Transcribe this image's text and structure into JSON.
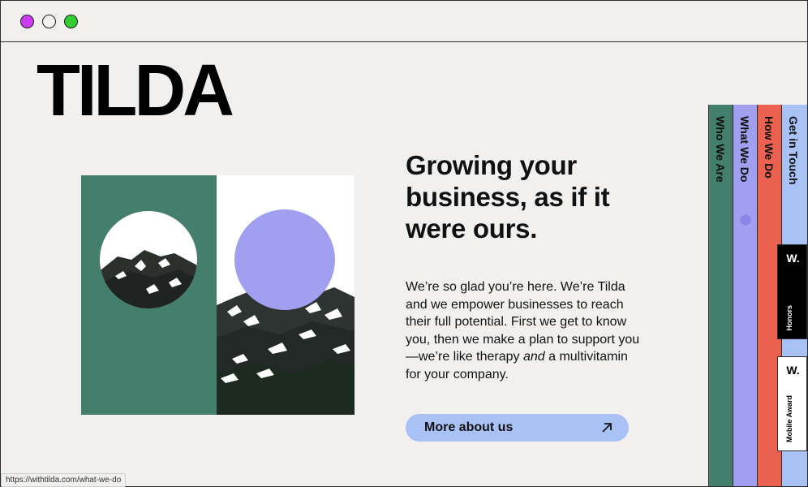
{
  "window": {
    "buttons": {
      "close_color": "#cc3cf0",
      "minimize_color": "#f1f0ee",
      "maximize_color": "#33cc33"
    }
  },
  "header": {
    "logo": "TILDA"
  },
  "hero": {
    "headline": "Growing your business, as if it were ours.",
    "body_part1": "We’re so glad you’re here. We’re Tilda and we empower businesses to reach their full potential. First we get to know you, then we make a plan to support you—we’re like therapy ",
    "body_em": "and",
    "body_part2": " a multivitamin for your company.",
    "cta_label": "More about us",
    "cta_icon": "arrow-up-right-icon"
  },
  "side_tabs": [
    {
      "label": "Who We Are",
      "color": "#447e6c"
    },
    {
      "label": "What We Do",
      "color": "#a19ff0"
    },
    {
      "label": "How We Do",
      "color": "#ea6150"
    },
    {
      "label": "Get in Touch",
      "color": "#a8c2f5"
    }
  ],
  "awards": [
    {
      "badge": "W.",
      "label": "Honors"
    },
    {
      "badge": "W.",
      "label": "Mobile Award"
    }
  ],
  "status_bar": {
    "url": "https://withtilda.com/what-we-do"
  },
  "colors": {
    "background": "#f1f0ee",
    "green": "#447e6c",
    "lavender": "#a19ff0",
    "coral": "#ea6150",
    "light_blue": "#a8c2f5"
  }
}
